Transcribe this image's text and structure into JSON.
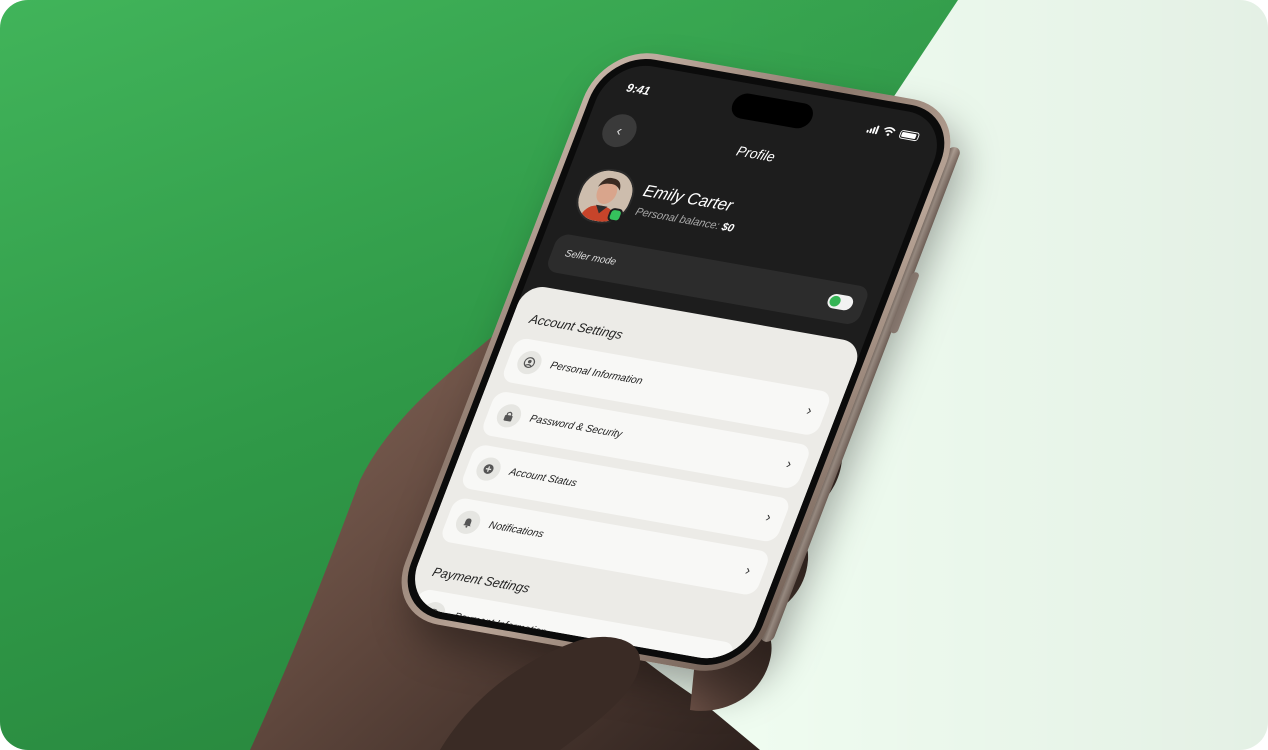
{
  "status_bar": {
    "time": "9:41"
  },
  "header": {
    "back_icon": "chevron-left-icon",
    "title": "Profile"
  },
  "profile": {
    "name": "Emily Carter",
    "balance_label": "Personal balance:",
    "balance_value": "$0"
  },
  "seller_mode": {
    "label": "Seller mode",
    "enabled": true
  },
  "account_settings": {
    "title": "Account Settings",
    "items": [
      {
        "label": "Personal Information",
        "icon": "user-icon"
      },
      {
        "label": "Password & Security",
        "icon": "lock-icon"
      },
      {
        "label": "Account Status",
        "icon": "status-icon"
      },
      {
        "label": "Notifications",
        "icon": "bell-icon"
      }
    ]
  },
  "payment_settings": {
    "title": "Payment Settings",
    "items": [
      {
        "label": "Payment Information",
        "icon": "dollar-icon"
      }
    ]
  },
  "colors": {
    "brand_green": "#35b455",
    "background_green": "#2f9847",
    "background_light": "#f0fdf1",
    "screen_dark": "#1d1d1d"
  }
}
